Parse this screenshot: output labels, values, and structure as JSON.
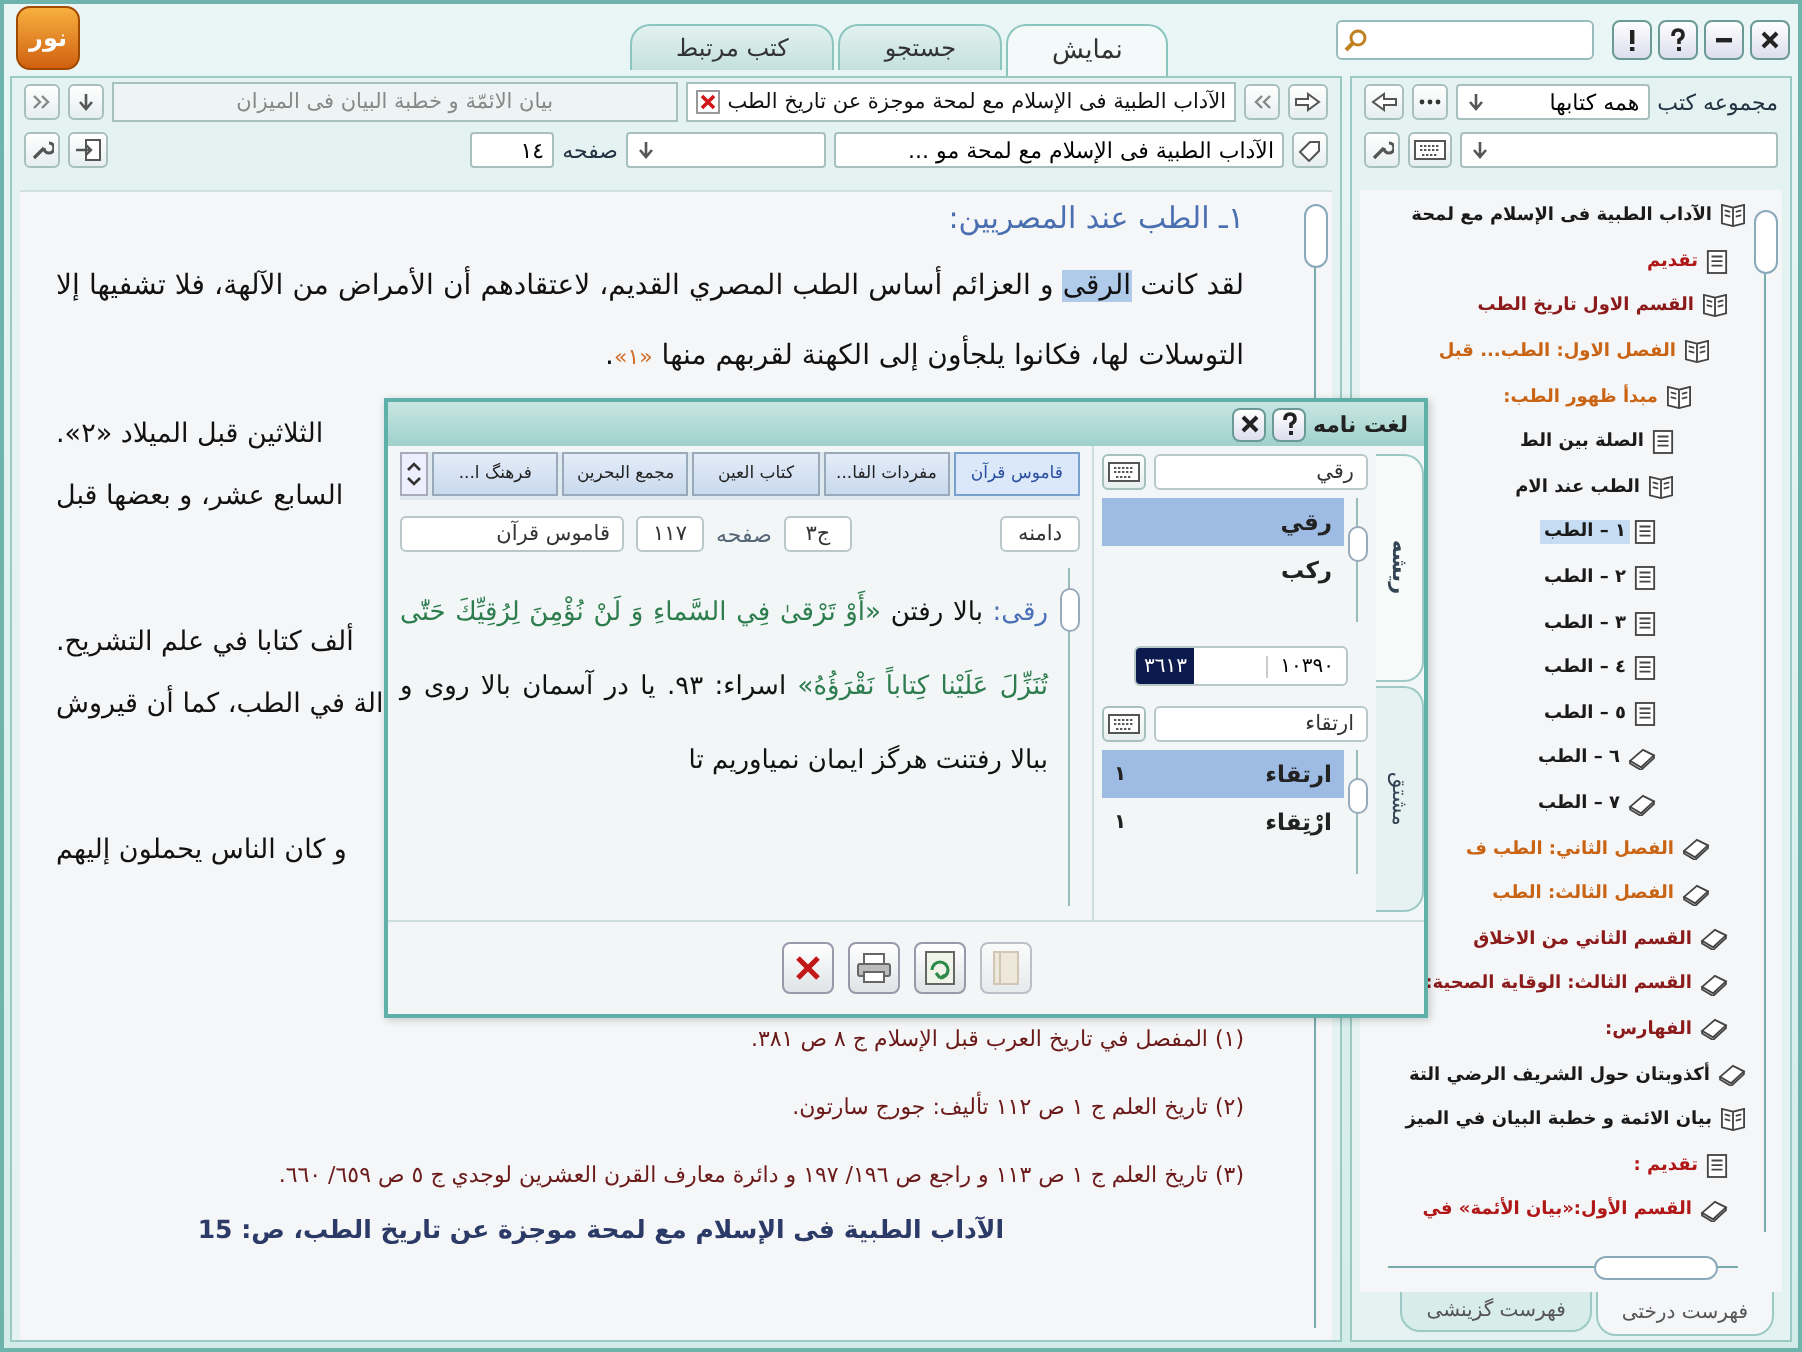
{
  "app": {
    "logo": "نور",
    "tabs": [
      {
        "label": "نمايش",
        "selected": true
      },
      {
        "label": "جستجو",
        "selected": false
      },
      {
        "label": "كتب مرتبط",
        "selected": false
      }
    ]
  },
  "reader": {
    "book_tabs": [
      {
        "label": "الآداب الطبية فى الإسلام مع لمحة موجزة عن تاريخ الطب",
        "selected": true
      },
      {
        "label": "بيان الائمّة و خطبة البيان فى الميزان",
        "selected": false
      }
    ],
    "book_select": "الآداب الطبية فى الإسلام مع لمحة مو ...",
    "page_label": "صفحه",
    "page": "١٤",
    "heading": "١ـ الطب عند المصريين:",
    "paragraph": [
      {
        "kind": "text",
        "text": "لقد كانت "
      },
      {
        "kind": "highlight",
        "text": "الرقى"
      },
      {
        "kind": "text",
        "text": " و العزائم أساس الطب المصري القديم، لاعتقادهم أن الأمراض من الآلهة، فلا تشفيها إلا التوسلات لها، فكانوا يلجأون إلى الكهنة لقربهم منها "
      },
      {
        "kind": "note",
        "text": "«١»"
      },
      {
        "kind": "text",
        "text": "."
      }
    ],
    "fragments": [
      [
        "الثلاثين قبل الميلاد «٢».",
        "السابع عشر، و بعضها قبل"
      ],
      [
        "ألف كتابا في علم التشريح.",
        "الة في الطب، كما أن قيروش"
      ],
      [
        "و كان الناس يحملون إليهم"
      ]
    ],
    "footnotes": [
      "(١) المفصل في تاريخ العرب قبل الإسلام ج ٨ ص ٣٨١.",
      "(٢) تاريخ العلم ج ١ ص ١١٢ تأليف: جورج سارتون.",
      "(٣) تاريخ العلم ج ١ ص ١١٣ و راجع ص ١٩٦/ ١٩٧ و دائرة معارف القرن العشرين لوجدي ج ٥ ص ٦٥٩/ ٦٦٠."
    ],
    "page_footer": "الآداب الطبية فى الإسلام مع لمحة موجزة عن تاريخ الطب، ص: 15"
  },
  "sidebar": {
    "collection_label": "مجموعه كتب",
    "collection": "همه كتابها",
    "tree": [
      {
        "kind": "book",
        "expanded": true,
        "label": "الآداب الطبية فى الإسلام مع لمحة",
        "color": "#1a1a1a",
        "selected": false,
        "children": [
          {
            "kind": "page",
            "label": "تقديم",
            "color": "#b01818",
            "selected": false
          },
          {
            "kind": "book",
            "expanded": true,
            "label": "القسم الاول تاريخ الطب",
            "color": "#8b1a1a",
            "selected": false,
            "children": [
              {
                "kind": "book",
                "expanded": true,
                "label": "الفصل الاول: الطب... قبل",
                "color": "#c86414",
                "selected": false,
                "children": [
                  {
                    "kind": "book",
                    "expanded": true,
                    "label": "مبدأ ظهور الطب:",
                    "color": "#c86414",
                    "selected": false,
                    "children": [
                      {
                        "kind": "page",
                        "label": "الصلة بين الط",
                        "color": "#1a1a1a",
                        "selected": false
                      },
                      {
                        "kind": "book",
                        "expanded": true,
                        "label": "الطب عند الام",
                        "color": "#1a1a1a",
                        "selected": false,
                        "children": [
                          {
                            "kind": "page",
                            "label": "١ – الطب",
                            "color": "#1a1a1a",
                            "selected": true
                          },
                          {
                            "kind": "page",
                            "label": "٢ – الطب",
                            "color": "#1a1a1a",
                            "selected": false
                          },
                          {
                            "kind": "page",
                            "label": "٣ – الطب",
                            "color": "#1a1a1a",
                            "selected": false
                          },
                          {
                            "kind": "page",
                            "label": "٤ – الطب",
                            "color": "#1a1a1a",
                            "selected": false
                          },
                          {
                            "kind": "page",
                            "label": "٥ – الطب",
                            "color": "#1a1a1a",
                            "selected": false
                          },
                          {
                            "kind": "book",
                            "expanded": false,
                            "label": "٦ – الطب",
                            "color": "#1a1a1a",
                            "selected": false
                          },
                          {
                            "kind": "book",
                            "expanded": false,
                            "label": "٧ – الطب",
                            "color": "#1a1a1a",
                            "selected": false
                          }
                        ]
                      }
                    ]
                  }
                ]
              },
              {
                "kind": "book",
                "expanded": false,
                "label": "الفصل الثاني: الطب ف",
                "color": "#c86414",
                "selected": false
              },
              {
                "kind": "book",
                "expanded": false,
                "label": "الفصل الثالث: الطب",
                "color": "#c86414",
                "selected": false
              }
            ]
          },
          {
            "kind": "book",
            "expanded": false,
            "label": "القسم الثاني من الاخلاق",
            "color": "#8b1a1a",
            "selected": false
          },
          {
            "kind": "book",
            "expanded": false,
            "label": "القسم الثالث: الوقاية الصحية:",
            "color": "#8b1a1a",
            "selected": false
          },
          {
            "kind": "book",
            "expanded": false,
            "label": "الفهارس:",
            "color": "#8b1a1a",
            "selected": false
          }
        ]
      },
      {
        "kind": "book",
        "expanded": false,
        "label": "أكذوبتان حول الشريف الرضي التة",
        "color": "#1a1a1a",
        "selected": false
      },
      {
        "kind": "book",
        "expanded": true,
        "label": "بيان الائمة و خطبة البيان في الميز",
        "color": "#1a1a1a",
        "selected": false,
        "children": [
          {
            "kind": "page",
            "label": "تقديم :",
            "color": "#b01818",
            "selected": false
          },
          {
            "kind": "book",
            "expanded": false,
            "label": "القسم الأول:«بيان الأئمة» في",
            "color": "#b01818",
            "selected": false
          }
        ]
      }
    ],
    "bottom_tabs": [
      {
        "label": "فهرست درختى",
        "selected": true
      },
      {
        "label": "فهرست گزينشى",
        "selected": false
      }
    ]
  },
  "dialog": {
    "title": "لغت نامه",
    "side_tabs": [
      {
        "label": "ريشه",
        "selected": true
      },
      {
        "label": "مشتق",
        "selected": false
      }
    ],
    "root_field": "رقي",
    "roots": [
      {
        "label": "رقي",
        "selected": true
      },
      {
        "label": "ركب",
        "selected": false
      }
    ],
    "counter": {
      "total": "١٠٣٩٠",
      "current": "٣٦١٣"
    },
    "derived_field": "ارتقاء",
    "derived": [
      {
        "label": "ارتقاء",
        "count": "١",
        "selected": true
      },
      {
        "label": "ارْتِقاء",
        "count": "١",
        "selected": false
      }
    ],
    "dict_tabs": [
      {
        "label": "قاموس قرآن",
        "selected": true
      },
      {
        "label": "مفردات الفا...",
        "selected": false
      },
      {
        "label": "كتاب العين",
        "selected": false
      },
      {
        "label": "مجمع البحرين",
        "selected": false
      },
      {
        "label": "فرهنگ ا...",
        "selected": false
      }
    ],
    "domain_label": "دامنه",
    "volume": "ج٣",
    "page_label": "صفحه",
    "page": "١١٧",
    "source": "قاموس قرآن",
    "entry": [
      {
        "kind": "term",
        "text": "رقى: "
      },
      {
        "kind": "text",
        "text": "بالا رفتن "
      },
      {
        "kind": "quran",
        "text": "«أَوْ تَرْقىٰ فِي السَّماءِ وَ لَنْ نُؤْمِنَ لِرُقِيِّكَ حَتّٰى تُنَزِّلَ عَلَيْنا كِتاباً نَقْرَؤُهُ»"
      },
      {
        "kind": "text",
        "text": " اسراء: ۹۳. يا در آسمان بالا روى و ببالا رفتنت هرگز ايمان نمياوريم تا"
      }
    ],
    "buttons": [
      {
        "kind": "close",
        "disabled": false
      },
      {
        "kind": "print",
        "disabled": false
      },
      {
        "kind": "refresh",
        "disabled": false
      },
      {
        "kind": "book",
        "disabled": true
      }
    ]
  }
}
